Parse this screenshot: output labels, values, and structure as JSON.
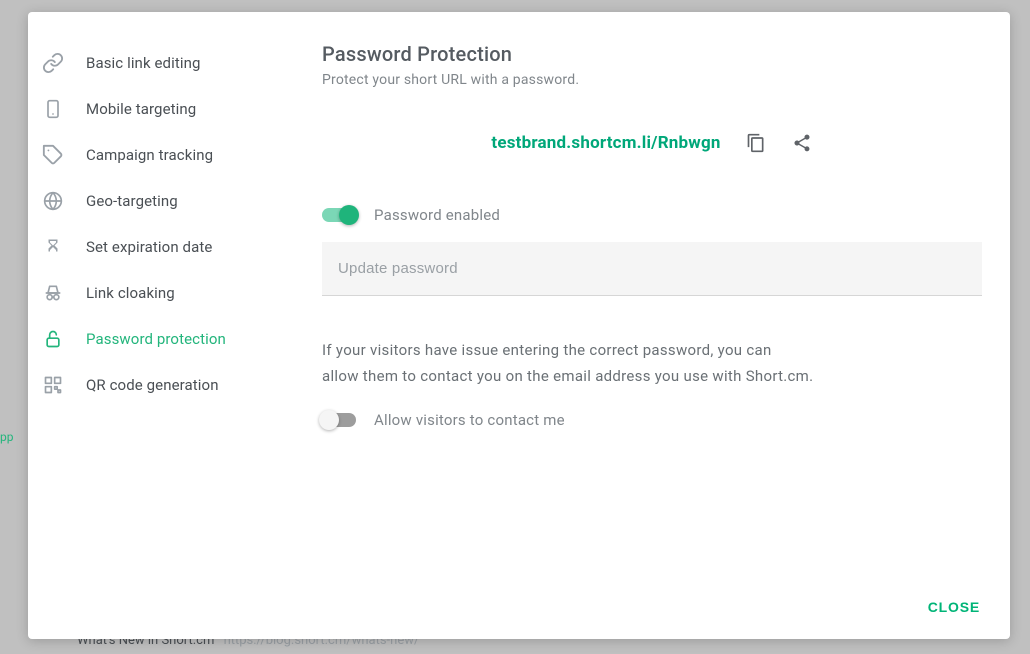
{
  "sidebar": {
    "items": [
      {
        "label": "Basic link editing"
      },
      {
        "label": "Mobile targeting"
      },
      {
        "label": "Campaign tracking"
      },
      {
        "label": "Geo-targeting"
      },
      {
        "label": "Set expiration date"
      },
      {
        "label": "Link cloaking"
      },
      {
        "label": "Password protection"
      },
      {
        "label": "QR code generation"
      }
    ]
  },
  "main": {
    "title": "Password Protection",
    "subtitle": "Protect your short URL with a password.",
    "short_url": "testbrand.shortcm.li/Rnbwgn",
    "password_enabled_label": "Password enabled",
    "password_placeholder": "Update password",
    "info_text_line1": "If your visitors have issue entering the correct password, you can",
    "info_text_line2": "allow them to contact you on the email address you use with Short.cm.",
    "allow_contact_label": "Allow visitors to contact me"
  },
  "footer": {
    "close_label": "CLOSE"
  },
  "background": {
    "bottom_title": "What's New in Short.cm",
    "bottom_url": "https://blog.short.cm/whats-new/",
    "side_text": "pp"
  }
}
